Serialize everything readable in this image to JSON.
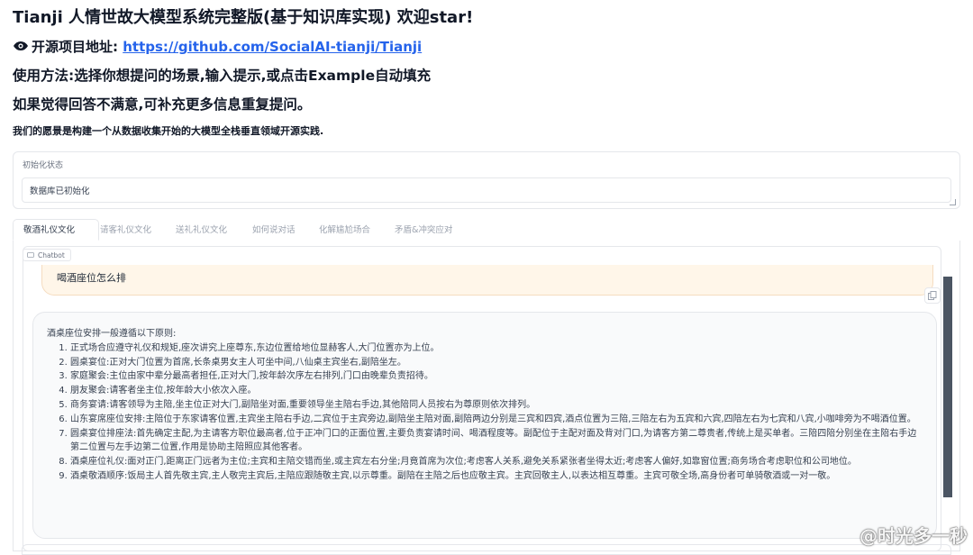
{
  "header": {
    "title": "Tianji 人情世故大模型系统完整版(基于知识库实现) 欢迎star!",
    "repo_prefix": "开源项目地址:",
    "repo_link": "https://github.com/SocialAI-tianji/Tianji",
    "usage": "使用方法:选择你想提问的场景,输入提示,或点击Example自动填充",
    "retry": "如果觉得回答不满意,可补充更多信息重复提问。",
    "vision": "我们的愿景是构建一个从数据收集开始的大模型全栈垂直领域开源实践."
  },
  "status": {
    "label": "初始化状态",
    "value": "数据库已初始化"
  },
  "tabs": [
    {
      "label": "敬酒礼仪文化"
    },
    {
      "label": "请客礼仪文化"
    },
    {
      "label": "送礼礼仪文化"
    },
    {
      "label": "如何说对话"
    },
    {
      "label": "化解尴尬场合"
    },
    {
      "label": "矛盾&冲突应对"
    }
  ],
  "chatbot": {
    "tag": "Chatbot",
    "user_message": "喝酒座位怎么排",
    "bot_intro": "酒桌座位安排一般遵循以下原则:",
    "bot_items": [
      "正式场合应遵守礼仪和规矩,座次讲究上座尊东,东边位置给地位显赫客人,大门位置亦为上位。",
      "圆桌宴位:正对大门位置为首席,长条桌男女主人可坐中间,八仙桌主宾坐右,副陪坐左。",
      "家庭聚会:主位由家中辈分最高者担任,正对大门,按年龄次序左右排列,门口由晚辈负责招待。",
      "朋友聚会:请客者坐主位,按年龄大小依次入座。",
      "商务宴请:请客领导为主陪,坐主位正对大门,副陪坐对面,重要领导坐主陪右手边,其他陪同人员按右为尊原则依次排列。",
      "山东宴席座位安排:主陪位于东家请客位置,主宾坐主陪右手边,二宾位于主宾旁边,副陪坐主陪对面,副陪两边分别是三宾和四宾,酒点位置为三陪,三陪左右为五宾和六宾,四陪左右为七宾和八宾,小咖啡旁为不喝酒位置。",
      "圆桌宴位排座法:首先确定主配,为主请客方职位最高者,位于正冲门口的正面位置,主要负责宴请时间、喝酒程度等。副配位于主配对面及背对门口,为请客方第二尊贵者,传统上是买单者。三陪四陪分别坐在主陪右手边第二位置与左手边第二位置,作用是协助主陪照应其他客者。",
      "酒桌座位礼仪:面对正门,距离正门远者为主位;主宾和主陪交错而坐,或主宾左右分坐;月竟首席为次位;考虑客人关系,避免关系紧张者坐得太近;考虑客人偏好,如靠窗位置;商务场合考虑职位和公司地位。",
      "酒桌敬酒顺序:饭局主人首先敬主宾,主人敬完主宾后,主陪应跟随敬主宾,以示尊重。副陪在主陪之后也应敬主宾。主宾回敬主人,以表达相互尊重。主宾可敬全场,高身份者可单骑敬酒或一对一敬。"
    ]
  },
  "watermark": "@时光多一秒"
}
